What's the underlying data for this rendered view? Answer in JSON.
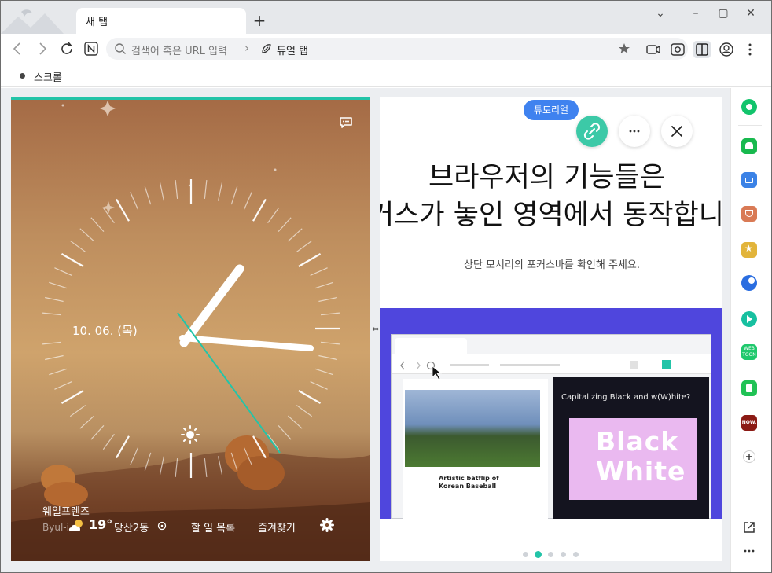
{
  "tab": {
    "title": "새 탭"
  },
  "toolbar": {
    "omnibox_placeholder": "검색어 혹은 URL 입력",
    "dual_tab_label": "듀얼 탭"
  },
  "bookmarks": [
    {
      "label": "스크롤"
    }
  ],
  "clock": {
    "date": "10. 06. (목)"
  },
  "weather": {
    "source": "웨일프렌즈",
    "source_sub": "Byul-i",
    "temperature": "19°",
    "location": "당산2동"
  },
  "left_links": {
    "todo": "할 일 목록",
    "favorites": "즐겨찾기"
  },
  "tutorial": {
    "badge": "튜토리얼",
    "headline_line1": "브라우저의 기능들은",
    "headline_line2": "커스가 놓인 영역에서 동작합니",
    "subtitle": "상단 모서리의 포커스바를 확인해 주세요.",
    "illustration": {
      "article_title": "Artistic batflip of Korean Baseball",
      "right_title": "Capitalizing Black and w(W)hite?",
      "word1": "Black",
      "word2": "White"
    },
    "pager": {
      "count": 5,
      "active": 2
    }
  },
  "sidebar": {
    "icons": [
      {
        "name": "whale-green-icon",
        "color": "#12c46c"
      },
      {
        "name": "talk-icon",
        "color": "#18b94e"
      },
      {
        "name": "work-icon",
        "color": "#3b82e6"
      },
      {
        "name": "pocket-icon",
        "color": "#d97a55"
      },
      {
        "name": "bookmark-star-icon",
        "color": "#e2b43a"
      },
      {
        "name": "translate-icon",
        "color": "#2a6de0"
      },
      {
        "name": "video-play-icon",
        "color": "#17c0a0"
      },
      {
        "name": "webtoon-icon",
        "color": "#1fc86c",
        "text": "WEB TOON"
      },
      {
        "name": "note-icon",
        "color": "#20c255"
      },
      {
        "name": "now-icon",
        "color": "#8b1a14",
        "text": "NOW."
      }
    ]
  },
  "colors": {
    "accent": "#23c4a8",
    "badge": "#3f82ef"
  }
}
